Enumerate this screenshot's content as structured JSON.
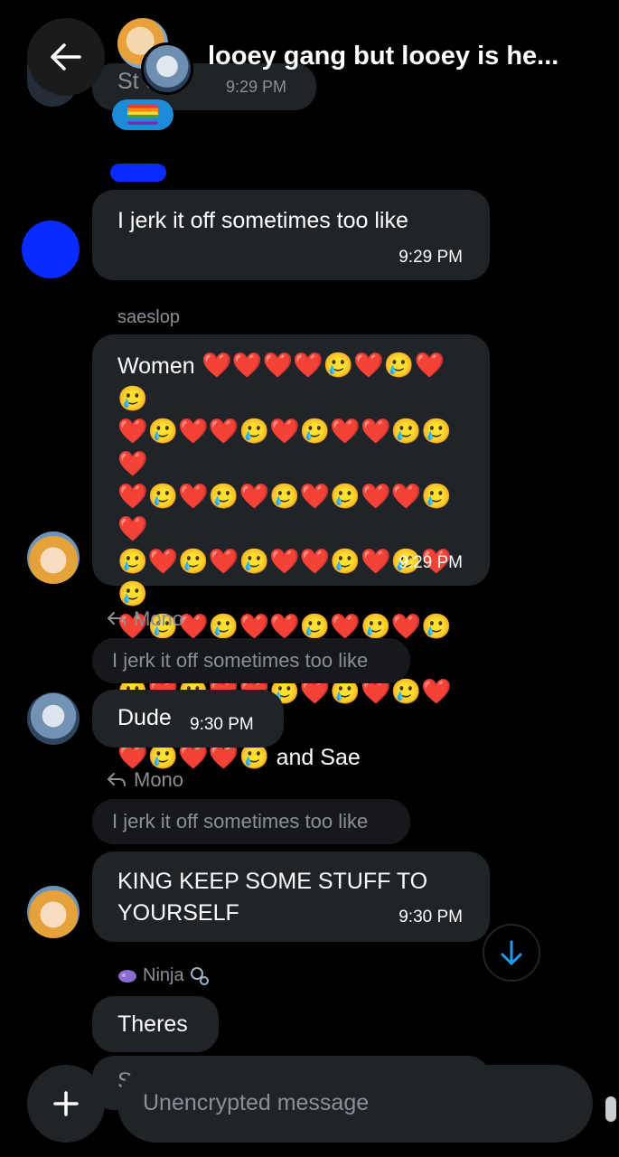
{
  "header": {
    "title": "looey gang but looey is he..."
  },
  "top_partial": {
    "text": "St  ot",
    "time": "9:29 PM",
    "reaction": "rainbow-flag"
  },
  "messages": [
    {
      "text": "I jerk it off sometimes too like",
      "time": "9:29 PM"
    },
    {
      "sender": "saeslop",
      "word": "Women",
      "emoji_line1": "❤️❤️❤️❤️🥲❤️🥲❤️🥲",
      "emoji_line2": "❤️🥲❤️❤️🥲❤️🥲❤️❤️🥲🥲❤️",
      "emoji_line3": "❤️🥲❤️🥲❤️🥲❤️🥲❤️❤️🥲❤️",
      "emoji_line4": "🥲❤️🥲❤️🥲❤️❤️🥲❤️🥲❤️🥲",
      "emoji_line5": "❤️🥲❤️🥲❤️❤️🥲❤️🥲❤️🥲❤️",
      "emoji_line6": "🥲❤️🥲❤️❤️🥲❤️🥲❤️🥲❤️🥲",
      "emoji_line7": "❤️🥲❤️❤️🥲",
      "tail": "and Sae",
      "time": "9:29 PM"
    },
    {
      "reply_to": "Mono",
      "quote": "I jerk it off sometimes too like",
      "text": "Dude",
      "time": "9:30 PM"
    },
    {
      "reply_to": "Mono",
      "quote": "I jerk it off sometimes too like",
      "text": "KING KEEP SOME STUFF TO YOURSELF",
      "time": "9:30 PM"
    },
    {
      "sender": "Ninja",
      "text": "Theres"
    },
    {
      "text": "S"
    }
  ],
  "composer": {
    "placeholder": "Unencrypted message"
  },
  "colors": {
    "background": "#000000",
    "bubble": "#202327",
    "muted": "#8b9096",
    "accent": "#1d9bf0",
    "scribble": "#0a2bff"
  }
}
